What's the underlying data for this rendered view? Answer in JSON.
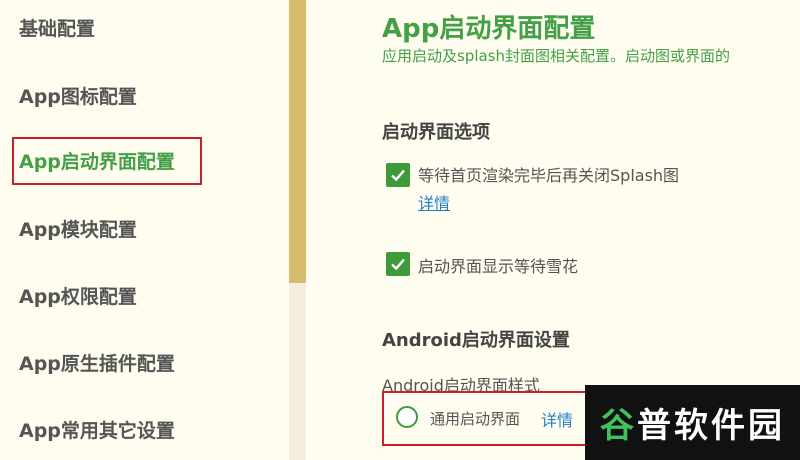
{
  "sidebar": {
    "items": [
      {
        "label": "基础配置"
      },
      {
        "label": "App图标配置"
      },
      {
        "label": "App启动界面配置"
      },
      {
        "label": "App模块配置"
      },
      {
        "label": "App权限配置"
      },
      {
        "label": "App原生插件配置"
      },
      {
        "label": "App常用其它设置"
      }
    ],
    "active_index": 2
  },
  "main": {
    "title": "App启动界面配置",
    "description": "应用启动及splash封面图相关配置。启动图或界面的",
    "splash_section": {
      "title": "启动界面选项",
      "options": [
        {
          "label": "等待首页渲染完毕后再关闭Splash图",
          "checked": true,
          "link": "详情"
        },
        {
          "label": "启动界面显示等待雪花",
          "checked": true
        }
      ]
    },
    "android_section": {
      "title": "Android启动界面设置",
      "style_label": "Android启动界面样式",
      "radio_option": {
        "label": "通用启动界面",
        "link": "详情",
        "selected": false
      }
    }
  },
  "watermark": {
    "text": "谷普软件园"
  },
  "colors": {
    "accent": "#43a047",
    "checkbox": "#3f9b3a",
    "link": "#1e7fc7",
    "highlight": "#c8202a",
    "scrollbar": "#d6bc6c",
    "background": "#fffdf0"
  }
}
